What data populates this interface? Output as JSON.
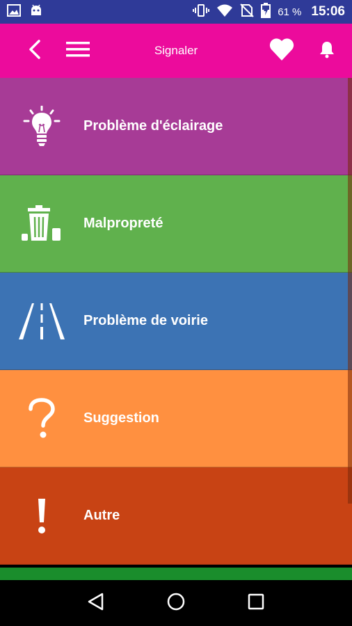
{
  "status_bar": {
    "icons": [
      "image-icon",
      "android-icon",
      "vibrate-icon",
      "wifi-icon",
      "no-sim-icon",
      "battery-charging-icon"
    ],
    "battery": "61 %",
    "time": "15:06"
  },
  "app_bar": {
    "title": "Signaler",
    "icons": [
      "back-arrow-icon",
      "menu-icon",
      "heart-icon",
      "bell-icon"
    ],
    "color": "#ec0b9c"
  },
  "categories": [
    {
      "label": "Problème d'éclairage",
      "icon": "lightbulb-icon",
      "color": "#a73b96"
    },
    {
      "label": "Malpropreté",
      "icon": "trash-can-icon",
      "color": "#60b14d"
    },
    {
      "label": "Problème de voirie",
      "icon": "road-icon",
      "color": "#3c73b4"
    },
    {
      "label": "Suggestion",
      "icon": "question-mark-icon",
      "color": "#ff9040"
    },
    {
      "label": "Autre",
      "icon": "exclamation-icon",
      "color": "#c84314"
    }
  ],
  "nav_bar": {
    "icons": [
      "back-triangle-icon",
      "home-circle-icon",
      "recents-square-icon"
    ]
  }
}
